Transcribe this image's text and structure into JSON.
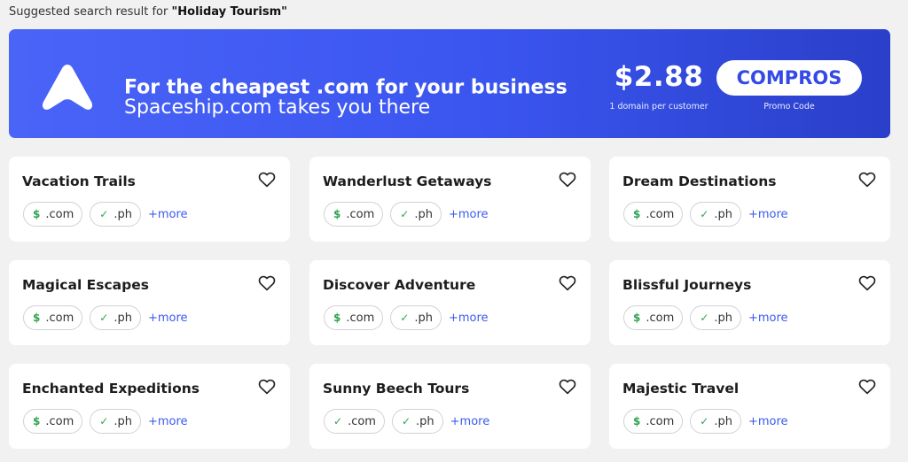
{
  "header": {
    "prefix": "Suggested search result for ",
    "query": "\"Holiday Tourism\""
  },
  "banner": {
    "title": "For the cheapest .com for your business",
    "subtitle": "Spaceship.com takes you there",
    "price": "$2.88",
    "price_note": "1 domain per customer",
    "promo_code": "COMPROS",
    "promo_note": "Promo Code",
    "background": "#3d58f2"
  },
  "icons": {
    "dollar": "$",
    "check": "✓"
  },
  "cards": [
    {
      "name": "Vacation Trails",
      "com": ".com",
      "ph": ".ph",
      "more": "+more"
    },
    {
      "name": "Wanderlust Getaways",
      "com": ".com",
      "ph": ".ph",
      "more": "+more"
    },
    {
      "name": "Dream Destinations",
      "com": ".com",
      "ph": ".ph",
      "more": "+more"
    },
    {
      "name": "Magical Escapes",
      "com": ".com",
      "ph": ".ph",
      "more": "+more"
    },
    {
      "name": "Discover Adventure",
      "com": ".com",
      "ph": ".ph",
      "more": "+more"
    },
    {
      "name": "Blissful Journeys",
      "com": ".com",
      "ph": ".ph",
      "more": "+more"
    },
    {
      "name": "Enchanted Expeditions",
      "com": ".com",
      "ph": ".ph",
      "more": "+more"
    },
    {
      "name": "Sunny Beech Tours",
      "com": ".com",
      "ph": ".ph",
      "more": "+more"
    },
    {
      "name": "Majestic Travel",
      "com": ".com",
      "ph": ".ph",
      "more": "+more"
    }
  ]
}
